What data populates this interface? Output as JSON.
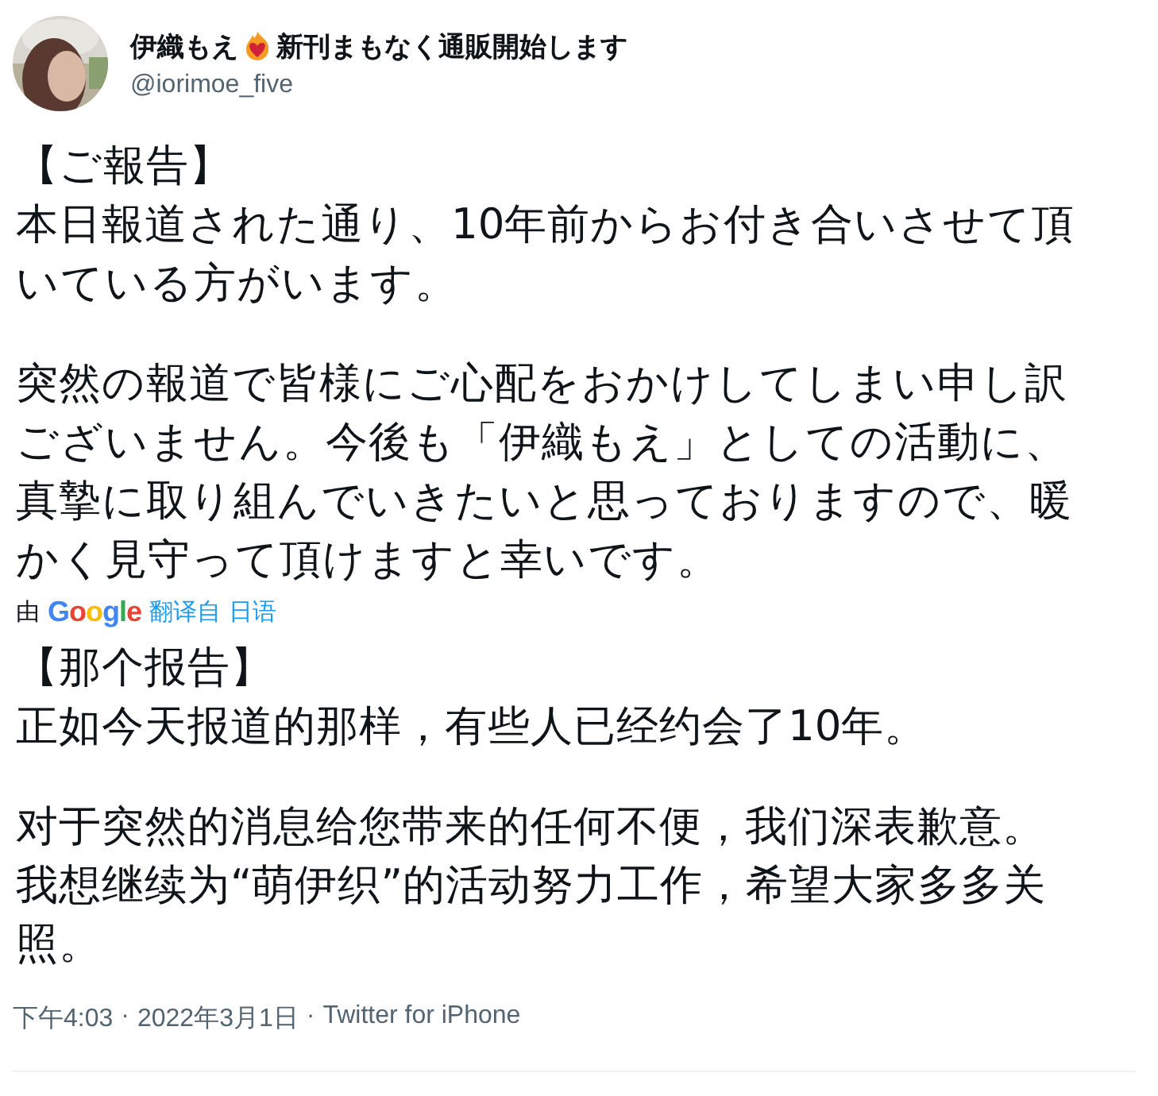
{
  "author": {
    "name_before_emoji": "伊織もえ",
    "name_after_emoji": "新刊まもなく通販開始します",
    "handle": "@iorimoe_five"
  },
  "original": {
    "paragraphs": [
      {
        "lines": [
          "【ご報告】",
          "本日報道された通り、10年前からお付き合いさせて頂",
          "いている方がいます。"
        ]
      },
      {
        "lines": [
          "突然の報道で皆様にご心配をおかけしてしまい申し訳",
          "ございません。今後も「伊織もえ」としての活動に、",
          "真摯に取り組んでいきたいと思っておりますので、暖",
          "かく見守って頂けますと幸いです。"
        ]
      }
    ]
  },
  "translation": {
    "prefix": "由",
    "logo": "Google",
    "link": "翻译自 日语"
  },
  "translated": {
    "paragraphs": [
      {
        "lines": [
          "【那个报告】",
          "正如今天报道的那样，有些人已经约会了10年。"
        ]
      },
      {
        "lines": [
          "对于突然的消息给您带来的任何不便，我们深表歉意。",
          "我想继续为“萌伊织”的活动努力工作，希望大家多多关",
          "照。"
        ]
      }
    ]
  },
  "footer": {
    "time": "下午4:03",
    "separator_1": "·",
    "date": "2022年3月1日",
    "separator_2": "·",
    "source": "Twitter for iPhone"
  }
}
